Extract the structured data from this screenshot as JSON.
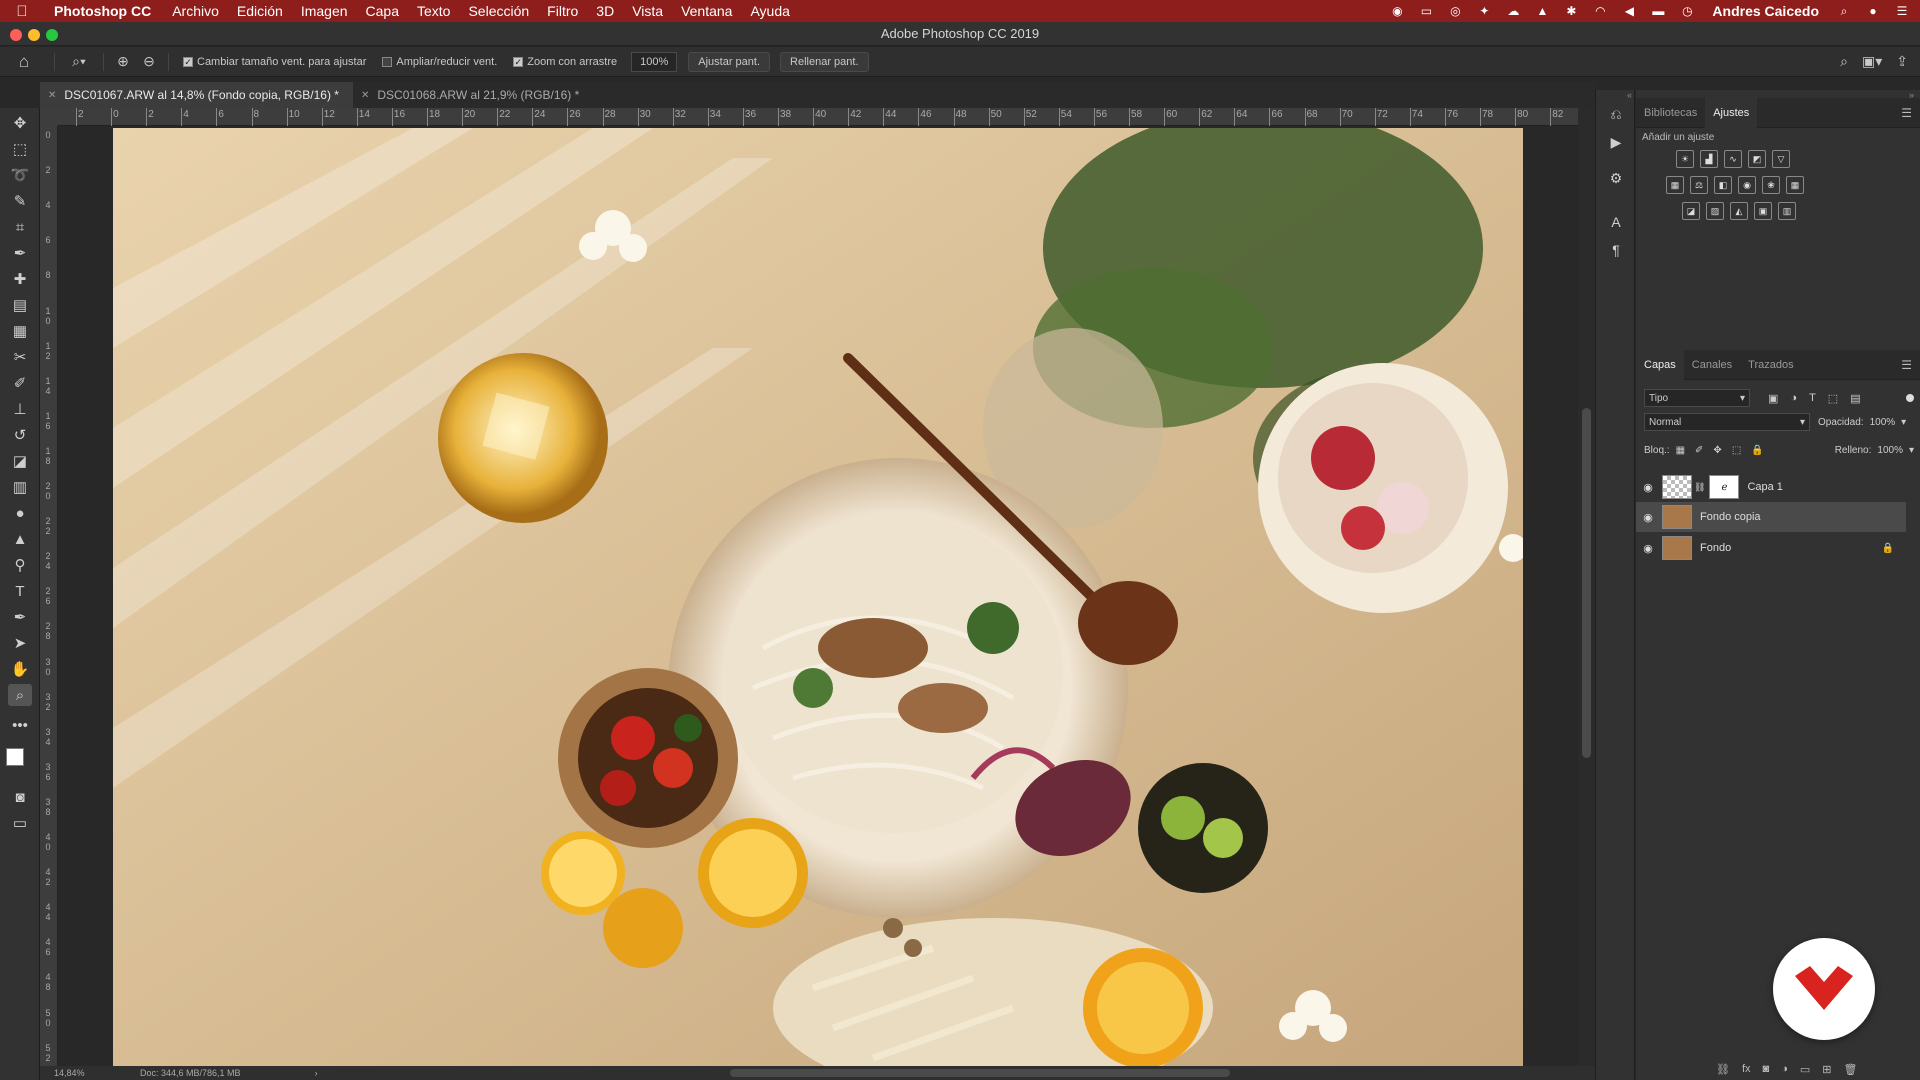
{
  "menubar": {
    "app": "Photoshop CC",
    "items": [
      "Archivo",
      "Edición",
      "Imagen",
      "Capa",
      "Texto",
      "Selección",
      "Filtro",
      "3D",
      "Vista",
      "Ventana",
      "Ayuda"
    ],
    "user": "Andres Caicedo"
  },
  "titlebar": {
    "title": "Adobe Photoshop CC 2019"
  },
  "options": {
    "resize_windows": {
      "label": "Cambiar tamaño vent. para ajustar",
      "checked": true
    },
    "zoom_all": {
      "label": "Ampliar/reducir vent.",
      "checked": false
    },
    "scrubby_zoom": {
      "label": "Zoom con arrastre",
      "checked": true
    },
    "zoom_value": "100%",
    "fit_screen": "Ajustar pant.",
    "fill_screen": "Rellenar pant."
  },
  "tabs": [
    {
      "label": "DSC01067.ARW al 14,8% (Fondo copia, RGB/16) *",
      "active": true
    },
    {
      "label": "DSC01068.ARW al 21,9% (RGB/16) *",
      "active": false
    }
  ],
  "ruler": {
    "top_ticks": [
      "2",
      "0",
      "2",
      "4",
      "6",
      "8",
      "10",
      "12",
      "14",
      "16",
      "18",
      "20",
      "22",
      "24",
      "26",
      "28",
      "30",
      "32",
      "34",
      "36",
      "38",
      "40",
      "42",
      "44",
      "46",
      "48",
      "50",
      "52",
      "54",
      "56",
      "58",
      "60",
      "62",
      "64",
      "66",
      "68",
      "70",
      "72",
      "74",
      "76",
      "78",
      "80",
      "82"
    ],
    "left_ticks": [
      "0",
      "2",
      "4",
      "6",
      "8",
      "1\n0",
      "1\n2",
      "1\n4",
      "1\n6",
      "1\n8",
      "2\n0",
      "2\n2",
      "2\n4",
      "2\n6",
      "2\n8",
      "3\n0",
      "3\n2",
      "3\n4",
      "3\n6",
      "3\n8",
      "4\n0",
      "4\n2",
      "4\n4",
      "4\n6",
      "4\n8",
      "5\n0",
      "5\n2"
    ]
  },
  "status": {
    "zoom": "14,84%",
    "doc": "Doc: 344,6 MB/786,1 MB"
  },
  "panels": {
    "top_tabs": [
      "Bibliotecas",
      "Ajustes"
    ],
    "adjust_hint": "Añadir un ajuste",
    "layer_tabs": [
      "Capas",
      "Canales",
      "Trazados"
    ],
    "filter": "Tipo",
    "blend_mode": "Normal",
    "opacity_label": "Opacidad:",
    "opacity": "100%",
    "lock_label": "Bloq.:",
    "fill_label": "Relleno:",
    "fill": "100%",
    "layers": [
      {
        "name": "Capa 1",
        "selected": false,
        "has_mask": true,
        "locked": false
      },
      {
        "name": "Fondo copia",
        "selected": true,
        "has_mask": false,
        "locked": false
      },
      {
        "name": "Fondo",
        "selected": false,
        "has_mask": false,
        "locked": true
      }
    ]
  },
  "colors": {
    "menubar": "#8d1e1c",
    "accent_red": "#d8231f"
  }
}
